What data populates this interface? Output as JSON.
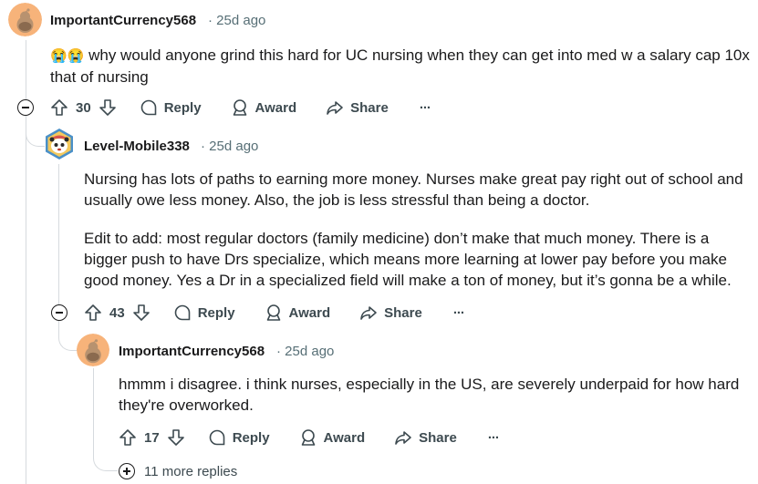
{
  "comments": [
    {
      "username": "ImportantCurrency568",
      "time": "25d ago",
      "emoji": "😭😭",
      "lines": [
        "why would anyone grind this hard for UC nursing when they can get into med w a salary cap 10x",
        "that of nursing"
      ],
      "votes": "30",
      "reply": "Reply",
      "award": "Award",
      "share": "Share",
      "more": "···"
    },
    {
      "username": "Level-Mobile338",
      "time": "25d ago",
      "para1": [
        "Nursing has lots of paths to earning more money. Nurses make great pay right out of school and",
        "usually owe less money. Also, the job is less stressful than being a doctor."
      ],
      "para2": [
        "Edit to add: most regular doctors (family medicine) don’t make that much money. There is a",
        "bigger push to have Drs specialize, which means more learning at lower pay before you make",
        "good money. Yes a Dr in a specialized field will make a ton of money, but it’s gonna be a while."
      ],
      "votes": "43",
      "reply": "Reply",
      "award": "Award",
      "share": "Share",
      "more": "···"
    },
    {
      "username": "ImportantCurrency568",
      "time": "25d ago",
      "lines": [
        "hmmm i disagree. i think nurses, especially in the US, are severely underpaid for how hard",
        "they're overworked."
      ],
      "votes": "17",
      "reply": "Reply",
      "award": "Award",
      "share": "Share",
      "more": "···",
      "more_replies": "11 more replies"
    }
  ],
  "colors": {
    "text": "#1a1a1b",
    "meta": "#576f76",
    "line": "#d6dade",
    "avatar_bg": "#f7b37a"
  }
}
